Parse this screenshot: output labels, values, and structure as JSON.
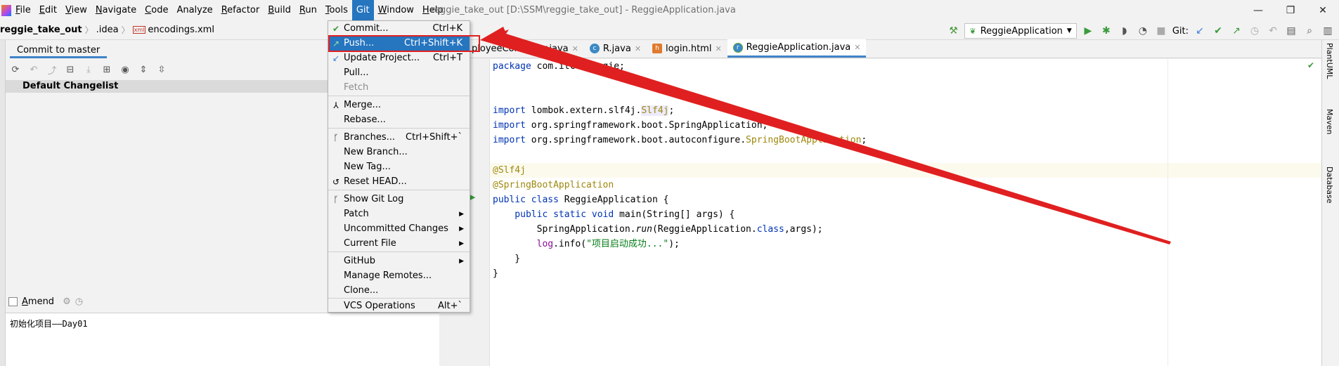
{
  "menubar": {
    "items": [
      {
        "u": "F",
        "rest": "ile"
      },
      {
        "u": "E",
        "rest": "dit"
      },
      {
        "u": "V",
        "rest": "iew"
      },
      {
        "u": "N",
        "rest": "avigate"
      },
      {
        "u": "C",
        "rest": "ode"
      },
      {
        "u": "",
        "rest": "Analyze"
      },
      {
        "u": "R",
        "rest": "efactor"
      },
      {
        "u": "B",
        "rest": "uild"
      },
      {
        "u": "R",
        "rest": "un"
      },
      {
        "u": "T",
        "rest": "ools"
      },
      {
        "u": "",
        "rest": "Git"
      },
      {
        "u": "W",
        "rest": "indow"
      },
      {
        "u": "H",
        "rest": "elp"
      }
    ],
    "window_title": "reggie_take_out [D:\\SSM\\reggie_take_out] - ReggieApplication.java"
  },
  "navbar": {
    "project": "reggie_take_out",
    "folder": ".idea",
    "file_icon_text": "xml",
    "file": "encodings.xml",
    "run_config": "ReggieApplication",
    "git_label": "Git:"
  },
  "commit_panel": {
    "tab": "Commit to master",
    "changelist": "Default Changelist",
    "amend_label": "Amend",
    "amend_u": "A",
    "amend_rest": "mend",
    "message": "初始化项目——Day01"
  },
  "editor": {
    "tabs": [
      {
        "label": "ployeeController.java",
        "icon": "c"
      },
      {
        "label": "R.java",
        "icon": "c"
      },
      {
        "label": "login.html",
        "icon": "h"
      },
      {
        "label": "ReggieApplication.java",
        "icon": "r"
      }
    ],
    "code": {
      "l1_kw": "package",
      "l1_rest": " com.itcf.reggie;",
      "l2_kw": "import",
      "l2_a": " lombok.extern.slf4j.",
      "l2_b": "Slf4j",
      "l2_c": ";",
      "l3_kw": "import",
      "l3_rest": " org.springframework.boot.SpringApplication;",
      "l4_kw": "import",
      "l4_a": " org.springframework.boot.autoconfigure.",
      "l4_b": "SpringBootApplication",
      "l4_c": ";",
      "l5": "@Slf4j",
      "l6": "@SpringBootApplication",
      "l7_kw": "public class",
      "l7_rest": " ReggieApplication {",
      "l8_kw": "    public static void",
      "l8_rest": " main(String[] args) {",
      "l9_a": "        SpringApplication.",
      "l9_b": "run",
      "l9_c": "(ReggieApplication.",
      "l9_d": "class",
      "l9_e": ",args);",
      "l10_a": "        ",
      "l10_b": "log",
      "l10_c": ".info(",
      "l10_d": "\"项目启动成功...\"",
      "l10_e": ");",
      "l11": "    }",
      "l12": "}"
    }
  },
  "right_tools": [
    "PlantUML",
    "Maven",
    "Database"
  ],
  "git_menu": {
    "items": [
      {
        "label": "Commit...",
        "shortcut": "Ctrl+K",
        "icon": "✔",
        "icon_color": "#3a9b3a"
      },
      {
        "label": "Push...",
        "shortcut": "Ctrl+Shift+K",
        "icon": "↗",
        "icon_color": "#7ed07e"
      },
      {
        "label": "Update Project...",
        "shortcut": "Ctrl+T",
        "icon": "↙",
        "icon_color": "#3b7dd8"
      },
      {
        "label": "Pull...",
        "shortcut": ""
      },
      {
        "label": "Fetch",
        "shortcut": ""
      },
      {
        "label": "Merge...",
        "shortcut": "",
        "icon": "⅄",
        "icon_color": "#555"
      },
      {
        "label": "Rebase...",
        "shortcut": ""
      },
      {
        "label": "Branches...",
        "shortcut": "Ctrl+Shift+`",
        "icon": "ᚴ",
        "icon_color": "#555"
      },
      {
        "label": "New Branch...",
        "shortcut": ""
      },
      {
        "label": "New Tag...",
        "shortcut": ""
      },
      {
        "label": "Reset HEAD...",
        "shortcut": "",
        "icon": "↺",
        "icon_color": "#555"
      },
      {
        "label": "Show Git Log",
        "shortcut": "",
        "icon": "ᚴ",
        "icon_color": "#555"
      },
      {
        "label": "Patch",
        "shortcut": ""
      },
      {
        "label": "Uncommitted Changes",
        "shortcut": ""
      },
      {
        "label": "Current File",
        "shortcut": ""
      },
      {
        "label": "GitHub",
        "shortcut": ""
      },
      {
        "label": "Manage Remotes...",
        "shortcut": ""
      },
      {
        "label": "Clone...",
        "shortcut": ""
      },
      {
        "label": "VCS Operations",
        "shortcut": "Alt+`"
      }
    ]
  },
  "colors": {
    "accent": "#2675bf",
    "annotation_red": "#e02020"
  }
}
